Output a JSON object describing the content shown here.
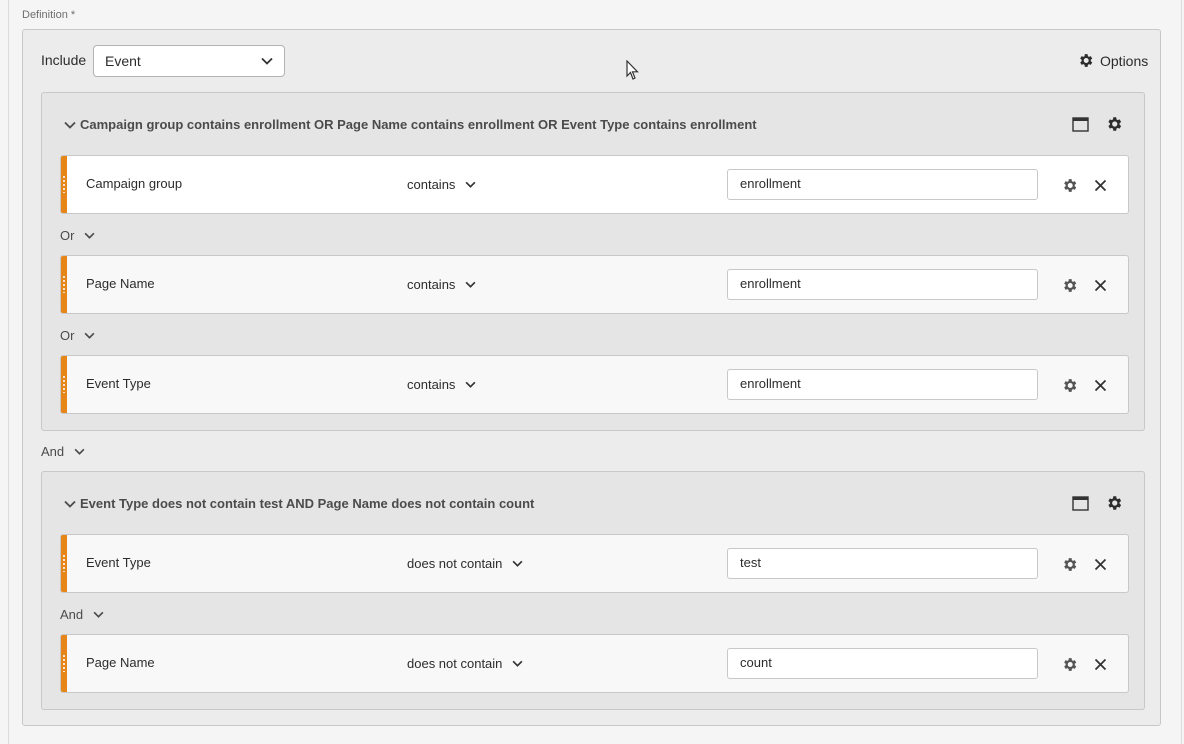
{
  "definition_label": "Definition",
  "required_mark": "*",
  "include": {
    "label": "Include",
    "selected": "Event"
  },
  "options_label": "Options",
  "containers": [
    {
      "title": "Campaign group contains enrollment OR Page Name contains enrollment OR Event Type contains enrollment",
      "rules": [
        {
          "dimension": "Campaign group",
          "operator": "contains",
          "value": "enrollment"
        },
        {
          "dimension": "Page Name",
          "operator": "contains",
          "value": "enrollment"
        },
        {
          "dimension": "Event Type",
          "operator": "contains",
          "value": "enrollment"
        }
      ],
      "connectors": [
        "Or",
        "Or"
      ]
    },
    {
      "title": "Event Type does not contain test AND Page Name does not contain count",
      "rules": [
        {
          "dimension": "Event Type",
          "operator": "does not contain",
          "value": "test"
        },
        {
          "dimension": "Page Name",
          "operator": "does not contain",
          "value": "count"
        }
      ],
      "connectors": [
        "And"
      ]
    }
  ],
  "container_connector": "And",
  "colors": {
    "accent": "#e68619",
    "background": "#ececec"
  }
}
